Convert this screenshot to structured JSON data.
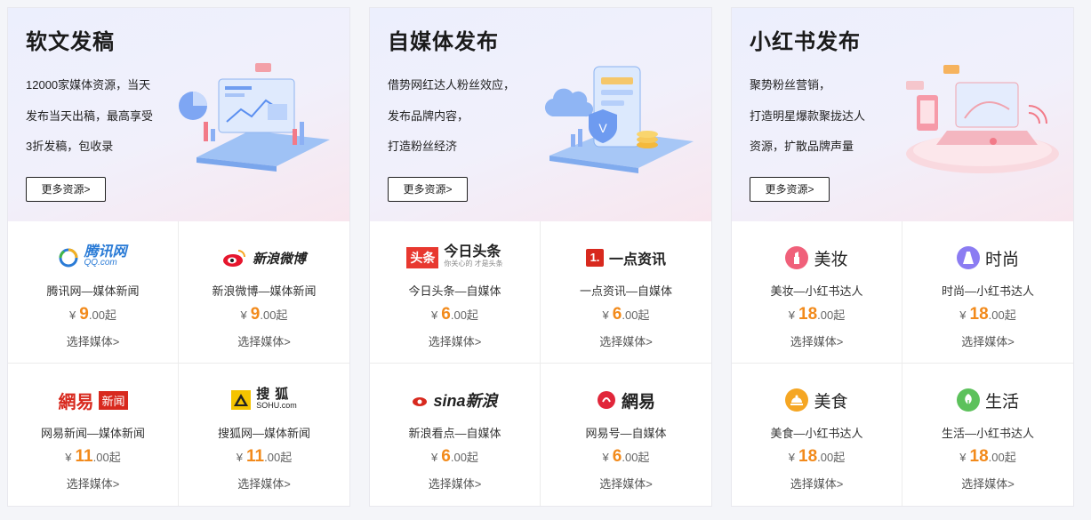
{
  "colors": {
    "price": "#f28a1b",
    "tencent_blue": "#2a7bd6",
    "netease_red": "#d8291e",
    "toutiao_red": "#e8382f"
  },
  "panels": [
    {
      "title": "软文发稿",
      "desc": [
        "12000家媒体资源，当天",
        "发布当天出稿，最高享受",
        "3折发稿，包收录"
      ],
      "more": "更多资源>",
      "items": [
        {
          "logo_text": "腾讯网",
          "logo_sub": "QQ.com",
          "name": "腾讯网—媒体新闻",
          "currency": "¥",
          "price_int": "9",
          "price_dec": ".00起",
          "link": "选择媒体>"
        },
        {
          "logo_text": "新浪微博",
          "name": "新浪微博—媒体新闻",
          "currency": "¥",
          "price_int": "9",
          "price_dec": ".00起",
          "link": "选择媒体>"
        },
        {
          "logo_text": "網易",
          "logo_badge": "新闻",
          "name": "网易新闻—媒体新闻",
          "currency": "¥",
          "price_int": "11",
          "price_dec": ".00起",
          "link": "选择媒体>"
        },
        {
          "logo_text": "搜狐",
          "logo_sub": "SOHU.com",
          "name": "搜狐网—媒体新闻",
          "currency": "¥",
          "price_int": "11",
          "price_dec": ".00起",
          "link": "选择媒体>"
        }
      ]
    },
    {
      "title": "自媒体发布",
      "desc": [
        "借势网红达人粉丝效应，",
        "发布品牌内容，",
        "打造粉丝经济"
      ],
      "more": "更多资源>",
      "items": [
        {
          "logo_badge": "头条",
          "logo_text": "今日头条",
          "logo_sub": "你关心的 才是头条",
          "name": "今日头条—自媒体",
          "currency": "¥",
          "price_int": "6",
          "price_dec": ".00起",
          "link": "选择媒体>"
        },
        {
          "logo_badge": "1.",
          "logo_text": "一点资讯",
          "name": "一点资讯—自媒体",
          "currency": "¥",
          "price_int": "6",
          "price_dec": ".00起",
          "link": "选择媒体>"
        },
        {
          "logo_text": "sina新浪",
          "name": "新浪看点—自媒体",
          "currency": "¥",
          "price_int": "6",
          "price_dec": ".00起",
          "link": "选择媒体>"
        },
        {
          "logo_text": "網易",
          "name": "网易号—自媒体",
          "currency": "¥",
          "price_int": "6",
          "price_dec": ".00起",
          "link": "选择媒体>"
        }
      ]
    },
    {
      "title": "小红书发布",
      "desc": [
        "聚势粉丝营销，",
        "打造明星爆款聚拢达人",
        "资源，扩散品牌声量"
      ],
      "more": "更多资源>",
      "items": [
        {
          "cat": "美妆",
          "icon_color": "#f0607a",
          "name": "美妆—小红书达人",
          "currency": "¥",
          "price_int": "18",
          "price_dec": ".00起",
          "link": "选择媒体>"
        },
        {
          "cat": "时尚",
          "icon_color": "#8b7cf2",
          "name": "时尚—小红书达人",
          "currency": "¥",
          "price_int": "18",
          "price_dec": ".00起",
          "link": "选择媒体>"
        },
        {
          "cat": "美食",
          "icon_color": "#f5a623",
          "name": "美食—小红书达人",
          "currency": "¥",
          "price_int": "18",
          "price_dec": ".00起",
          "link": "选择媒体>"
        },
        {
          "cat": "生活",
          "icon_color": "#5cc15b",
          "name": "生活—小红书达人",
          "currency": "¥",
          "price_int": "18",
          "price_dec": ".00起",
          "link": "选择媒体>"
        }
      ]
    }
  ]
}
